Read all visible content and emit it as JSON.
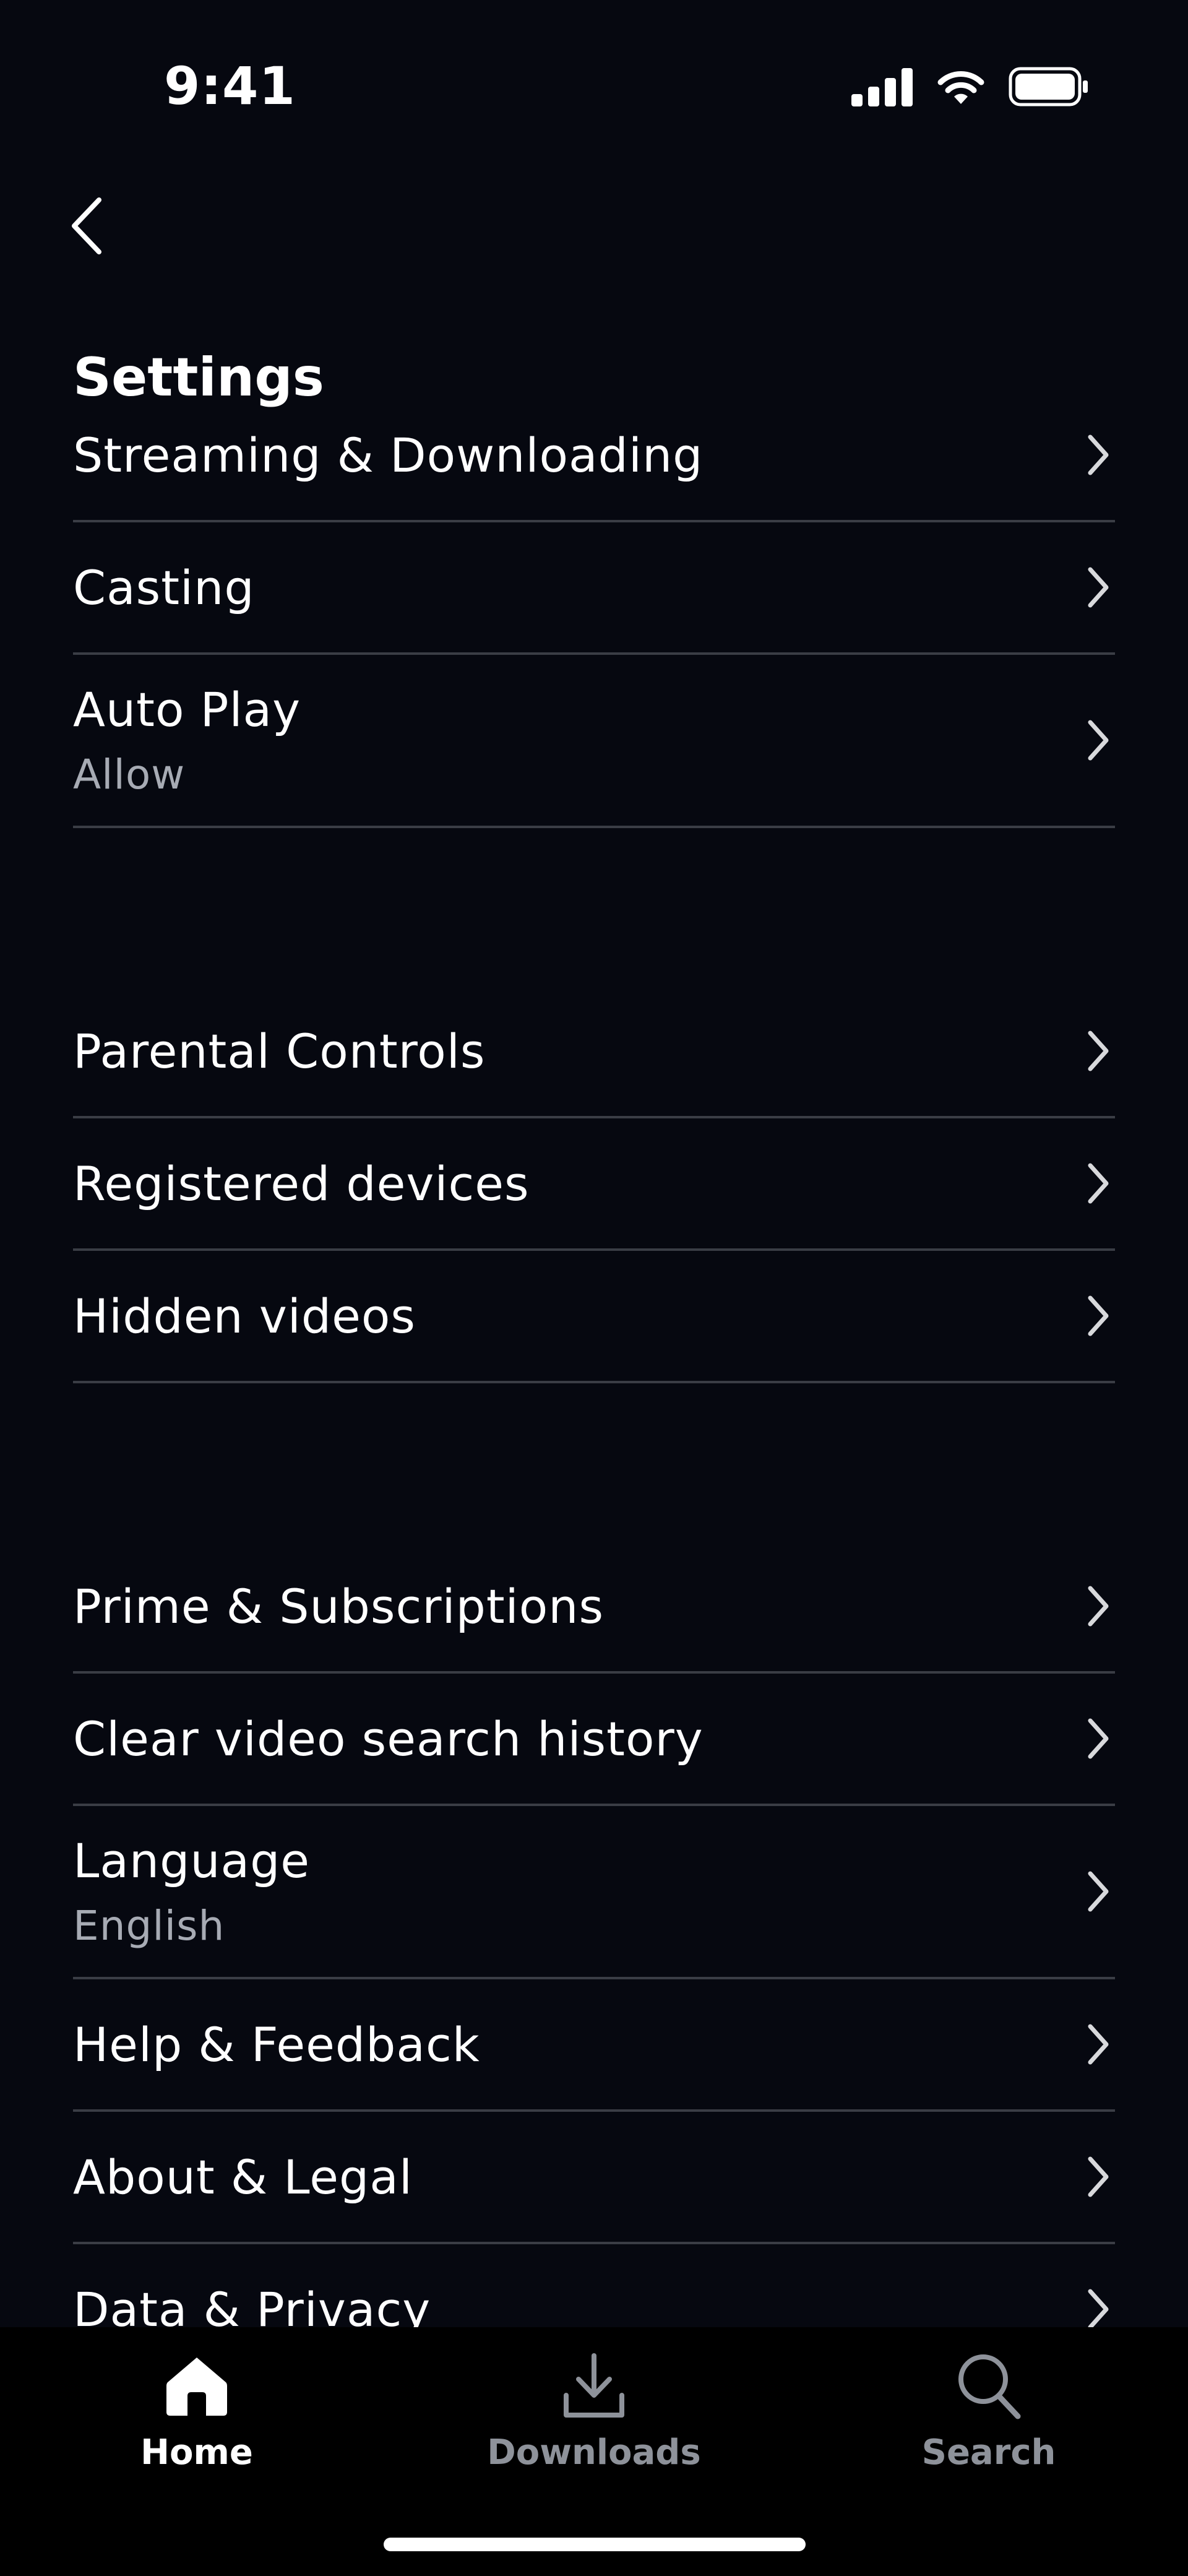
{
  "status_bar": {
    "time": "9:41",
    "icons": [
      "cellular-signal-icon",
      "wifi-icon",
      "battery-icon"
    ]
  },
  "header": {
    "back_icon": "chevron-left-icon",
    "title": "Settings"
  },
  "settings": {
    "groups": [
      {
        "items": [
          {
            "label": "Streaming & Downloading"
          },
          {
            "label": "Casting"
          },
          {
            "label": "Auto Play",
            "value": "Allow"
          }
        ]
      },
      {
        "items": [
          {
            "label": "Parental Controls"
          },
          {
            "label": "Registered devices"
          },
          {
            "label": "Hidden videos"
          }
        ]
      },
      {
        "items": [
          {
            "label": "Prime & Subscriptions"
          },
          {
            "label": "Clear video search history"
          },
          {
            "label": "Language",
            "value": "English"
          },
          {
            "label": "Help & Feedback"
          },
          {
            "label": "About & Legal"
          },
          {
            "label": "Data & Privacy"
          }
        ]
      }
    ]
  },
  "tab_bar": {
    "tabs": [
      {
        "label": "Home",
        "icon": "home-icon",
        "active": true
      },
      {
        "label": "Downloads",
        "icon": "download-icon",
        "active": false
      },
      {
        "label": "Search",
        "icon": "search-icon",
        "active": false
      }
    ]
  },
  "colors": {
    "background": "#060810",
    "divider": "#3a3d45",
    "secondary_text": "#a7abb4",
    "inactive_tab": "#8e929a",
    "tab_bar": "#000000"
  }
}
